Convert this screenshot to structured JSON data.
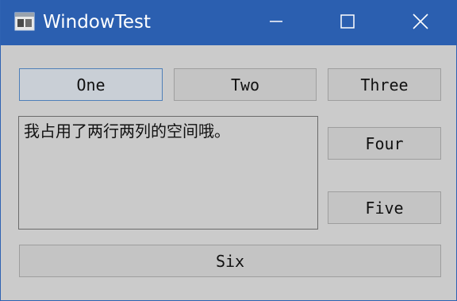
{
  "window": {
    "title": "WindowTest",
    "title_bar_color": "#2b5fb0",
    "background_color": "#cbcbcb",
    "icons": {
      "app": "app-window-icon",
      "minimize": "minimize-icon",
      "maximize": "maximize-icon",
      "close": "close-icon"
    }
  },
  "buttons": {
    "one": "One",
    "two": "Two",
    "three": "Three",
    "four": "Four",
    "five": "Five",
    "six": "Six"
  },
  "text_edit": {
    "value": "我占用了两行两列的空间哦。"
  },
  "focus": {
    "button": "one",
    "accent_color": "#4f7fb8"
  }
}
